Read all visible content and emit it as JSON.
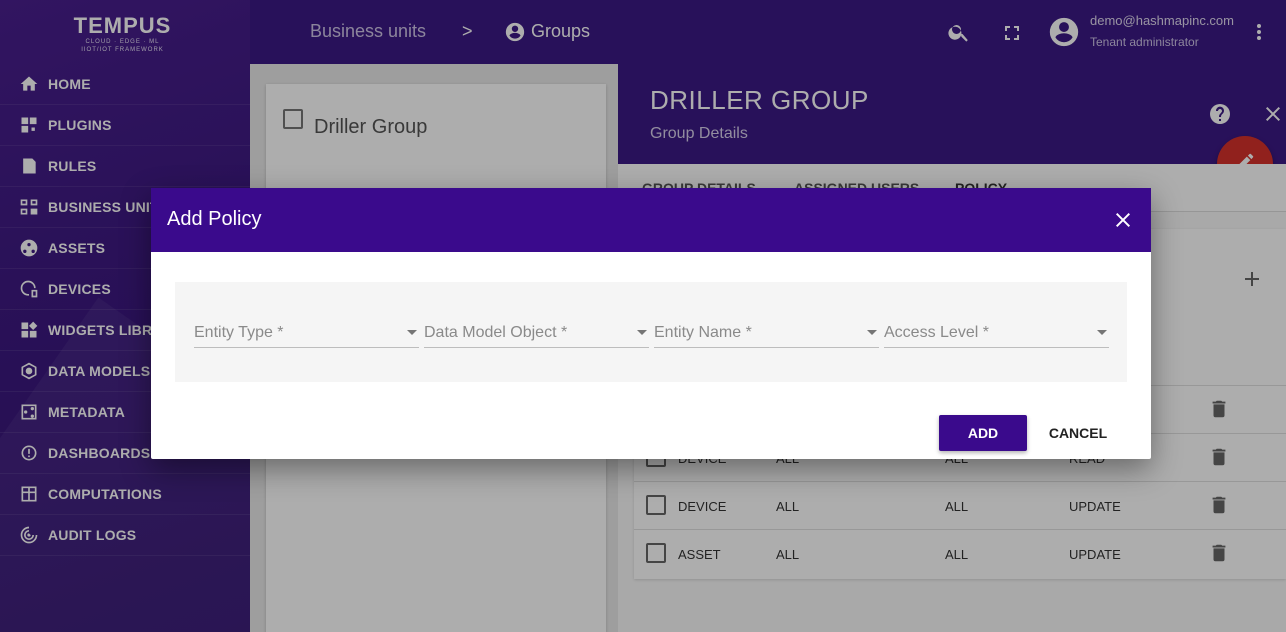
{
  "logo": {
    "main": "TEMPUS",
    "sub1": "CLOUD · EDGE · ML",
    "sub2": "IIOT/IOT FRAMEWORK"
  },
  "sidebar": {
    "items": [
      {
        "label": "HOME",
        "icon": "home-icon"
      },
      {
        "label": "PLUGINS",
        "icon": "plugins-icon"
      },
      {
        "label": "RULES",
        "icon": "rules-icon"
      },
      {
        "label": "BUSINESS UNITS",
        "icon": "business-units-icon"
      },
      {
        "label": "ASSETS",
        "icon": "assets-icon"
      },
      {
        "label": "DEVICES",
        "icon": "devices-icon"
      },
      {
        "label": "WIDGETS LIBRARY",
        "icon": "widgets-icon"
      },
      {
        "label": "DATA MODELS",
        "icon": "data-models-icon"
      },
      {
        "label": "METADATA",
        "icon": "metadata-icon"
      },
      {
        "label": "DASHBOARDS",
        "icon": "dashboards-icon"
      },
      {
        "label": "COMPUTATIONS",
        "icon": "computations-icon"
      },
      {
        "label": "AUDIT LOGS",
        "icon": "audit-logs-icon"
      }
    ]
  },
  "header": {
    "breadcrumb": {
      "first": "Business units",
      "separator": ">",
      "current": "Groups"
    },
    "user": {
      "email": "demo@hashmapinc.com",
      "role": "Tenant administrator"
    }
  },
  "group_list": {
    "item": "Driller Group"
  },
  "detail": {
    "title": "DRILLER GROUP",
    "subtitle": "Group Details",
    "tabs": [
      "GROUP DETAILS",
      "ASSIGNED USERS",
      "POLICY"
    ],
    "rows": [
      {
        "type": "DEVICE",
        "c2": "ALL",
        "c3": "ALL",
        "c4": "READ"
      },
      {
        "type": "DEVICE",
        "c2": "ALL",
        "c3": "ALL",
        "c4": "UPDATE"
      },
      {
        "type": "ASSET",
        "c2": "ALL",
        "c3": "ALL",
        "c4": "UPDATE"
      }
    ]
  },
  "dialog": {
    "title": "Add Policy",
    "fields": [
      "Entity Type *",
      "Data Model Object *",
      "Entity Name *",
      "Access Level *"
    ],
    "add_label": "ADD",
    "cancel_label": "CANCEL"
  },
  "colors": {
    "brand_purple": "#3c1a85",
    "dialog_header": "#3a0a8c",
    "fab_red": "#d6322c"
  }
}
